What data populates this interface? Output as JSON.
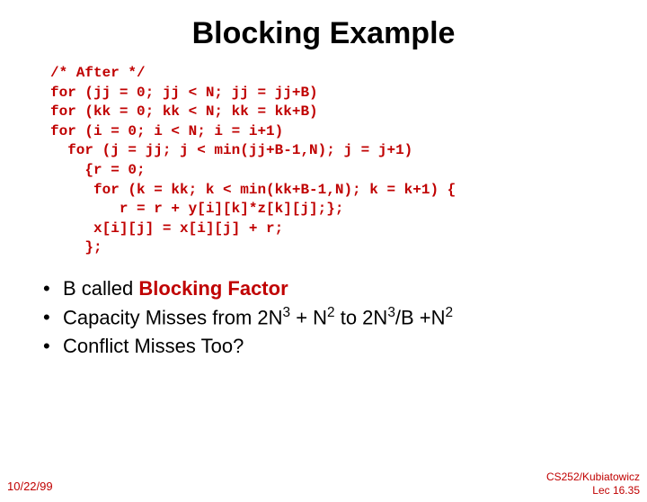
{
  "title": "Blocking Example",
  "code": "/* After */\nfor (jj = 0; jj < N; jj = jj+B)\nfor (kk = 0; kk < N; kk = kk+B)\nfor (i = 0; i < N; i = i+1)\n  for (j = jj; j < min(jj+B-1,N); j = j+1)\n    {r = 0;\n     for (k = kk; k < min(kk+B-1,N); k = k+1) {\n        r = r + y[i][k]*z[k][j];};\n     x[i][j] = x[i][j] + r;\n    };",
  "bullets": {
    "b1_pre": "B called ",
    "b1_red": "Blocking Factor",
    "b2": "Capacity Misses from 2N",
    "b2_mid": " + N",
    "b2_to": " to 2N",
    "b2_end": "/B +N",
    "b3": "Conflict Misses Too?"
  },
  "footer": {
    "date": "10/22/99",
    "right1": "CS252/Kubiatowicz",
    "right2": "Lec 16.35"
  }
}
